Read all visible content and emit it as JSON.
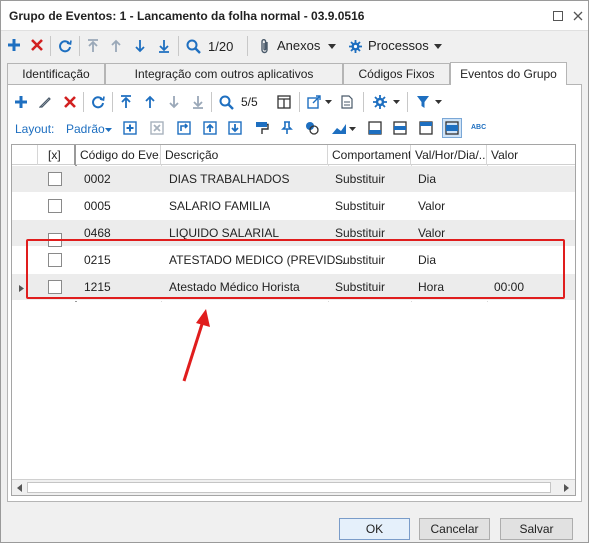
{
  "window": {
    "title": "Grupo de Eventos: 1 - Lancamento da folha normal - 03.9.0516"
  },
  "toolbar1": {
    "record_counter": "1/20",
    "anexos_label": "Anexos",
    "processos_label": "Processos"
  },
  "tabs": [
    {
      "label": "Identificação"
    },
    {
      "label": "Integração com outros aplicativos"
    },
    {
      "label": "Códigos Fixos"
    },
    {
      "label": "Eventos do Grupo"
    }
  ],
  "toolbar2": {
    "record_counter": "5/5"
  },
  "toolbar3": {
    "layout_label": "Layout:",
    "layout_value": "Padrão",
    "abc_label": "ABC"
  },
  "grid": {
    "columns": [
      {
        "label": "[x]"
      },
      {
        "label": "Código do Eve..."
      },
      {
        "label": "Descrição"
      },
      {
        "label": "Comportamento"
      },
      {
        "label": "Val/Hor/Dia/..."
      },
      {
        "label": "Valor"
      }
    ],
    "rows": [
      {
        "codigo": "0002",
        "descricao": "DIAS TRABALHADOS",
        "comportamento": "Substituir",
        "tipo": "Dia",
        "valor": ""
      },
      {
        "codigo": "0005",
        "descricao": "SALARIO FAMILIA",
        "comportamento": "Substituir",
        "tipo": "Valor",
        "valor": ""
      },
      {
        "codigo": "0468",
        "descricao": "LIQUIDO SALARIAL",
        "comportamento": "Substituir",
        "tipo": "Valor",
        "valor": ""
      },
      {
        "codigo": "0215",
        "descricao": "ATESTADO MEDICO (PREVID...",
        "comportamento": "Substituir",
        "tipo": "Dia",
        "valor": ""
      },
      {
        "codigo": "1215",
        "descricao": "Atestado Médico Horista",
        "comportamento": "Substituir",
        "tipo": "Hora",
        "valor": "00:00"
      }
    ]
  },
  "buttons": {
    "ok": "OK",
    "cancel": "Cancelar",
    "save": "Salvar"
  },
  "colors": {
    "accent_blue": "#1e6fc0",
    "delete_red": "#d22020",
    "annotation_red": "#e01d1d"
  }
}
